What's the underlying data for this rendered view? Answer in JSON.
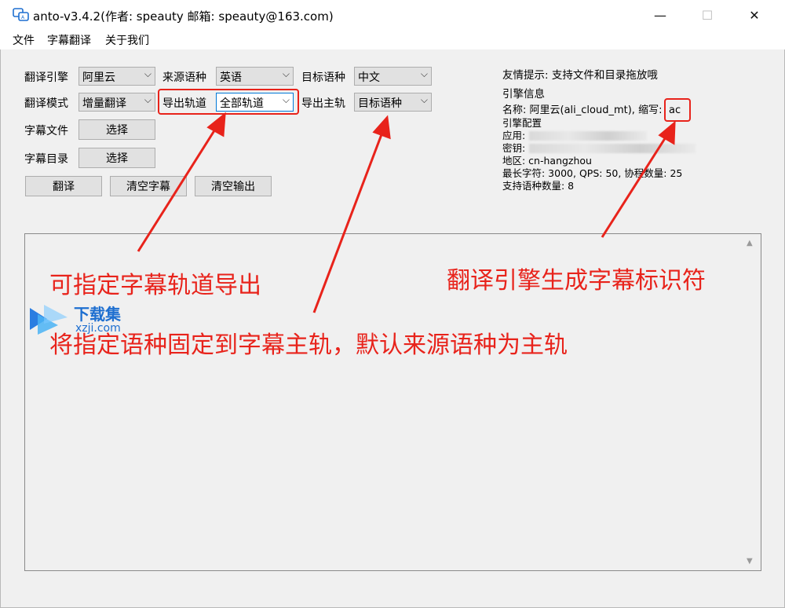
{
  "window": {
    "title": "anto-v3.4.2(作者: speauty 邮箱: speauty@163.com)",
    "minimize": "—",
    "maximize": "☐",
    "close": "✕"
  },
  "menu": [
    "文件",
    "字幕翻译",
    "关于我们"
  ],
  "form": {
    "engine_label": "翻译引擎",
    "engine_value": "阿里云",
    "source_lang_label": "来源语种",
    "source_lang_value": "英语",
    "target_lang_label": "目标语种",
    "target_lang_value": "中文",
    "mode_label": "翻译模式",
    "mode_value": "增量翻译",
    "export_track_label": "导出轨道",
    "export_track_value": "全部轨道",
    "main_track_label": "导出主轨",
    "main_track_value": "目标语种",
    "subtitle_file_label": "字幕文件",
    "subtitle_dir_label": "字幕目录",
    "select_button": "选择"
  },
  "actions": {
    "translate": "翻译",
    "clear_subtitles": "清空字幕",
    "clear_output": "清空输出"
  },
  "info": {
    "tip": "友情提示: 支持文件和目录拖放哦",
    "engine_info_title": "引擎信息",
    "name_line": "名称: 阿里云(ali_cloud_mt), 缩写:",
    "abbr": "ac",
    "config_title": "引擎配置",
    "app_label": "应用:",
    "key_label": "密钥:",
    "region_line": "地区: cn-hangzhou",
    "limits_line": "最长字符: 3000, QPS: 50, 协程数量: 25",
    "lang_count_line": "支持语种数量: 8"
  },
  "annotations": {
    "track_export": "可指定字幕轨道导出",
    "main_track": "将指定语种固定到字幕主轨，默认来源语种为主轨",
    "engine_id": "翻译引擎生成字幕标识符"
  },
  "watermark": {
    "logo_text": "下载集",
    "url": "xzji.com"
  },
  "colors": {
    "annotation_red": "#e8231b",
    "focus_blue": "#0078d7"
  }
}
